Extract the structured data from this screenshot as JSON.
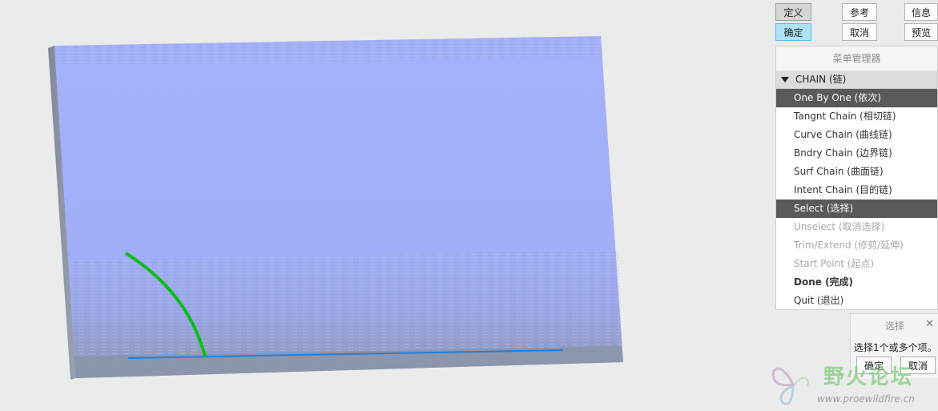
{
  "toolbar": {
    "define": "定义",
    "reference": "参考",
    "info": "信息",
    "ok": "确定",
    "cancel": "取消",
    "preview": "预览"
  },
  "menu": {
    "title": "菜单管理器",
    "header": "CHAIN (链)",
    "items": [
      {
        "label": "One By One (依次)",
        "state": "selected"
      },
      {
        "label": "Tangnt Chain (相切链)",
        "state": "normal"
      },
      {
        "label": "Curve Chain (曲线链)",
        "state": "normal"
      },
      {
        "label": "Bndry Chain (边界链)",
        "state": "normal"
      },
      {
        "label": "Surf Chain (曲面链)",
        "state": "normal"
      },
      {
        "label": "Intent Chain (目的链)",
        "state": "normal"
      },
      {
        "label": "Select (选择)",
        "state": "selected"
      },
      {
        "label": "Unselect (取消选择)",
        "state": "disabled"
      },
      {
        "label": "Trim/Extend (修剪/延伸)",
        "state": "disabled"
      },
      {
        "label": "Start Point (起点)",
        "state": "disabled"
      },
      {
        "label": "Done (完成)",
        "state": "bold"
      },
      {
        "label": "Quit (退出)",
        "state": "normal"
      }
    ]
  },
  "select_dialog": {
    "title": "选择",
    "message": "选择1个或多个项。",
    "ok": "确定",
    "cancel": "取消"
  },
  "watermark": {
    "name": "野火论坛",
    "url": "www.proewildfire.cn"
  },
  "colors": {
    "surface": "#a3b0fb",
    "side": "#8c96a6",
    "curve": "#0cbd1c",
    "edge": "#1f7fd6",
    "selected": "#595959",
    "active_button": "#aee3f7"
  }
}
